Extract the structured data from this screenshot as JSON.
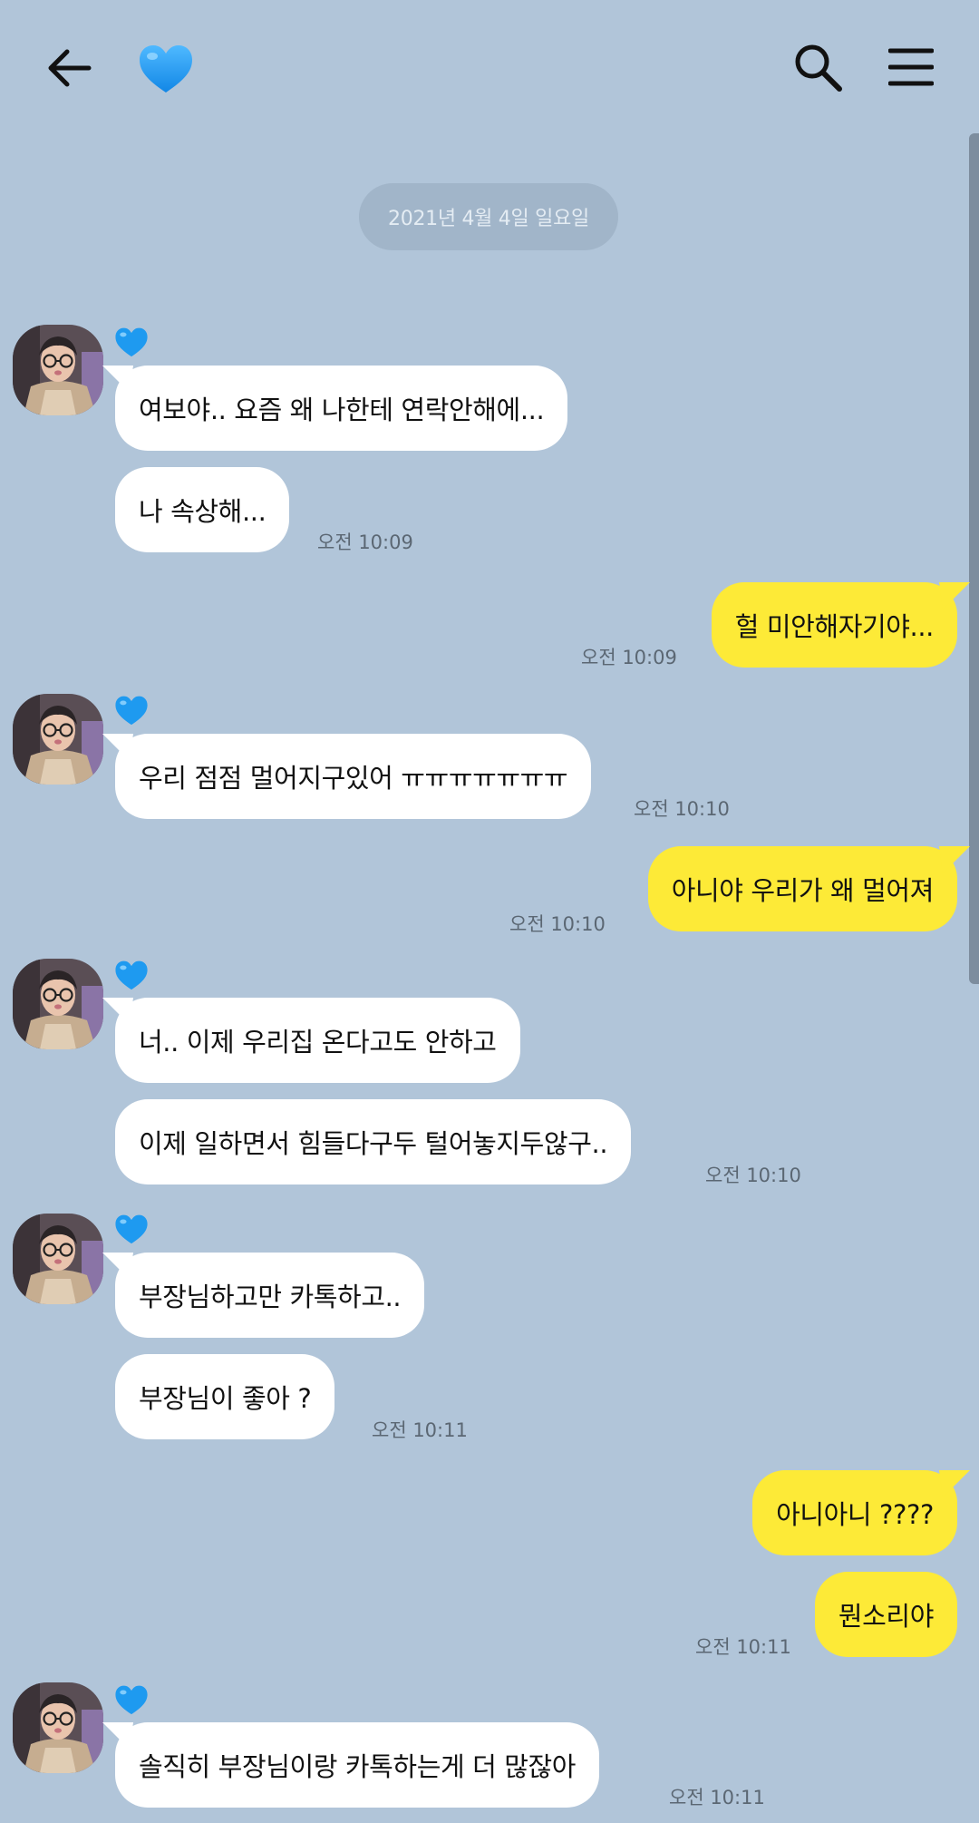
{
  "colors": {
    "background": "#b1c5d9",
    "incoming_bubble": "#ffffff",
    "outgoing_bubble": "#fdea37",
    "heart": "#1e9af0"
  },
  "header": {
    "back_icon": "arrow-left-icon",
    "title_icon": "blue-heart-emoji",
    "search_icon": "search-icon",
    "menu_icon": "hamburger-menu-icon"
  },
  "date_divider": "2021년 4월 4일 일요일",
  "messages": [
    {
      "text": "여보야.. 요즘 왜 나한테 연락안해에..."
    },
    {
      "text": "나 속상해...",
      "time": "오전 10:09"
    },
    {
      "text": "헐 미안해자기야...",
      "time": "오전 10:09"
    },
    {
      "text": "우리 점점 멀어지구있어 ㅠㅠㅠㅠㅠㅠㅠ",
      "time": "오전 10:10"
    },
    {
      "text": "아니야 우리가 왜 멀어져",
      "time": "오전 10:10"
    },
    {
      "text": "너.. 이제 우리집 온다고도 안하고"
    },
    {
      "text": "이제 일하면서 힘들다구두 털어놓지두않구..",
      "time": "오전 10:10"
    },
    {
      "text": "부장님하고만 카톡하고.."
    },
    {
      "text": "부장님이 좋아 ?",
      "time": "오전 10:11"
    },
    {
      "text": "아니아니 ????"
    },
    {
      "text": "뭔소리야",
      "time": "오전 10:11"
    },
    {
      "text": "솔직히 부장님이랑 카톡하는게 더 많잖아",
      "time": "오전 10:11"
    }
  ]
}
